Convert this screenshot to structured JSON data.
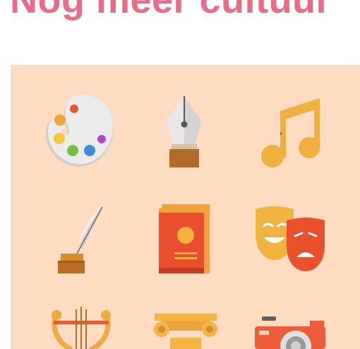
{
  "page": {
    "title": "Nog meer cultuur",
    "title_color": "#ec6a85"
  },
  "hero": {
    "background_color": "#fddcc2",
    "icons": [
      "palette-icon",
      "fountain-pen-icon",
      "music-note-icon",
      "quill-inkwell-icon",
      "book-icon",
      "theater-masks-icon",
      "lyre-icon",
      "column-capital-icon",
      "camera-icon"
    ]
  }
}
